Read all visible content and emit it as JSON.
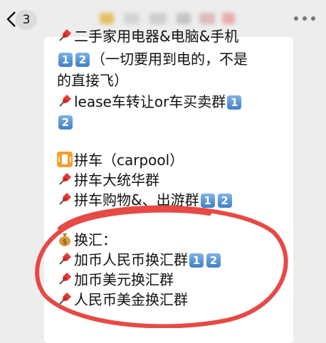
{
  "header": {
    "back_icon": "chevron-left-icon",
    "unread_count": "3",
    "more_icon": "more-dots-icon"
  },
  "message": {
    "lines": [
      {
        "icon": "pin",
        "text": "二手家用电器&电脑&手机",
        "badges": []
      },
      {
        "icon": "",
        "text": "（一切要用到电的，不是",
        "badges_before": [
          "1",
          "2"
        ]
      },
      {
        "icon": "",
        "text": "的直接飞）",
        "badges": []
      },
      {
        "icon": "pin",
        "text": "lease车转让or车买卖群",
        "badges": [
          "1"
        ]
      },
      {
        "icon": "",
        "text": "",
        "badges": [
          "2"
        ]
      },
      {
        "icon": "phone",
        "text": "拼车（carpool）",
        "badges": []
      },
      {
        "icon": "pin",
        "text": "拼车大统华群",
        "badges": []
      },
      {
        "icon": "pin",
        "text": "拼车购物&、出游群",
        "badges": [
          "1",
          "2"
        ]
      },
      {
        "icon": "moneybag",
        "text": "换汇：",
        "badges": []
      },
      {
        "icon": "pin",
        "text": "加币人民币换汇群",
        "badges": [
          "1",
          "2"
        ]
      },
      {
        "icon": "pin",
        "text": "加币美元换汇群",
        "badges": []
      },
      {
        "icon": "pin",
        "text": "人民币美金换汇群",
        "badges": []
      }
    ],
    "highlight_color": "#e53935"
  }
}
